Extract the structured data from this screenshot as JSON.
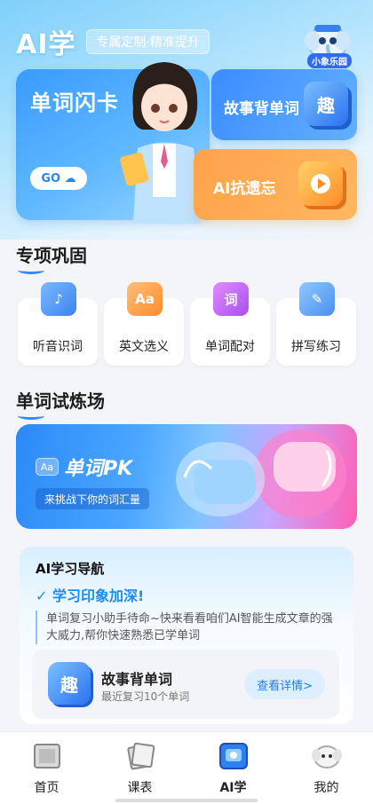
{
  "header": {
    "title": "AI学",
    "tagline": "专属定制·精准提升",
    "mascot_label": "小象乐园"
  },
  "hero": {
    "flash_title": "单词闪卡",
    "go_label": "GO",
    "story_title": "故事背单词",
    "story_tile": "趣",
    "ai_title": "AI抗遗忘"
  },
  "special": {
    "title": "专项巩固",
    "items": [
      {
        "label": "听音识词",
        "icon": "music-note-icon"
      },
      {
        "label": "英文选义",
        "icon": "aa-icon"
      },
      {
        "label": "单词配对",
        "icon": "word-icon"
      },
      {
        "label": "拼写练习",
        "icon": "pencil-icon"
      }
    ],
    "icon_text": {
      "aa": "Aa",
      "word": "词"
    }
  },
  "arena": {
    "title": "单词试炼场",
    "pk_badge": "Aa",
    "pk_title": "单词PK",
    "pk_subtitle": "来挑战下你的词汇量"
  },
  "ai_nav": {
    "title": "AI学习导航",
    "headline": "学习印象加深!",
    "description": "单词复习小助手待命~快来看看咱们AI智能生成文章的强大威力,帮你快速熟悉已学单词",
    "item": {
      "tile": "趣",
      "name": "故事背单词",
      "meta": "最近复习10个单词",
      "button": "查看详情>"
    }
  },
  "tabbar": {
    "tabs": [
      {
        "label": "首页",
        "icon": "home-book-icon"
      },
      {
        "label": "课表",
        "icon": "schedule-icon"
      },
      {
        "label": "AI学",
        "icon": "ai-learn-icon"
      },
      {
        "label": "我的",
        "icon": "profile-mascot-icon"
      }
    ],
    "active": "AI学"
  },
  "colors": {
    "accent": "#2f8cff",
    "orange": "#ffa24a",
    "pink": "#ff5fb4"
  }
}
